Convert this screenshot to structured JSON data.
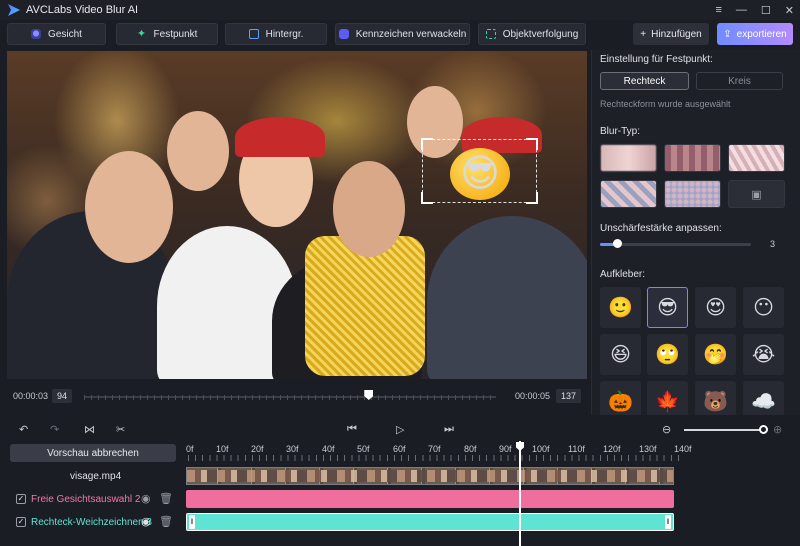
{
  "app": {
    "title": "AVCLabs Video Blur AI"
  },
  "window_controls": [
    "≡",
    "—",
    "☐",
    "✕"
  ],
  "toolbar": {
    "tools": [
      {
        "label": "Gesicht",
        "icon": "face-icon"
      },
      {
        "label": "Festpunkt",
        "icon": "fixed-point-icon"
      },
      {
        "label": "Hintergr.",
        "icon": "background-icon"
      },
      {
        "label": "Kennzeichen verwackeln",
        "icon": "license-plate-icon"
      },
      {
        "label": "Objektverfolgung",
        "icon": "object-tracking-icon"
      }
    ],
    "add_label": "Hinzufügen",
    "export_label": "exportieren"
  },
  "player": {
    "current_time": "00:00:03",
    "current_frame": "94",
    "total_time": "00:00:05",
    "total_frames": "137",
    "seek_fraction": 0.69
  },
  "panel": {
    "fixed_point_heading": "Einstellung für Festpunkt:",
    "shape_rect": "Rechteck",
    "shape_circle": "Kreis",
    "shape_hint": "Rechteckform wurde ausgewählt",
    "blur_type_heading": "Blur-Typ:",
    "strength_heading": "Unschärfestärke anpassen:",
    "strength_value": "3",
    "sticker_heading": "Aufkleber:",
    "stickers": [
      "🙂",
      "😎",
      "😍",
      "😶",
      "😆",
      "🙄",
      "🤭",
      "😭",
      "🎃",
      "🍁",
      "🐻",
      "☁️"
    ]
  },
  "timeline": {
    "cancel_preview": "Vorschau abbrechen",
    "video_track": "visage.mp4",
    "tracks": [
      {
        "label": "Freie Gesichtsauswahl 2",
        "color": "#f06e9e"
      },
      {
        "label": "Rechteck-Weichzeichnen 3",
        "color": "#5fe3d2"
      }
    ],
    "ruler": [
      "0f",
      "10f",
      "20f",
      "30f",
      "40f",
      "50f",
      "60f",
      "70f",
      "80f",
      "90f",
      "100f",
      "110f",
      "120f",
      "130f",
      "140f"
    ]
  }
}
